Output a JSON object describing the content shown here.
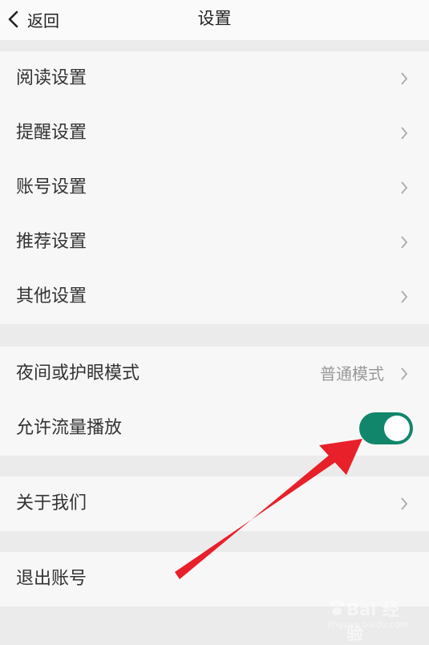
{
  "header": {
    "back_label": "返回",
    "title": "设置"
  },
  "group1": {
    "items": [
      {
        "label": "阅读设置"
      },
      {
        "label": "提醒设置"
      },
      {
        "label": "账号设置"
      },
      {
        "label": "推荐设置"
      },
      {
        "label": "其他设置"
      }
    ]
  },
  "group2": {
    "night_mode": {
      "label": "夜间或护眼模式",
      "value": "普通模式"
    },
    "allow_data_playback": {
      "label": "允许流量播放",
      "enabled": true
    }
  },
  "group3": {
    "about_label": "关于我们"
  },
  "group4": {
    "logout_label": "退出账号"
  },
  "colors": {
    "toggle_on": "#11866b",
    "arrow": "#e8202a",
    "background": "#ebebeb",
    "cell": "#f7f7f7"
  },
  "watermark": {
    "text": "Bai 经验",
    "sub": "jingyan.baidu.com"
  }
}
